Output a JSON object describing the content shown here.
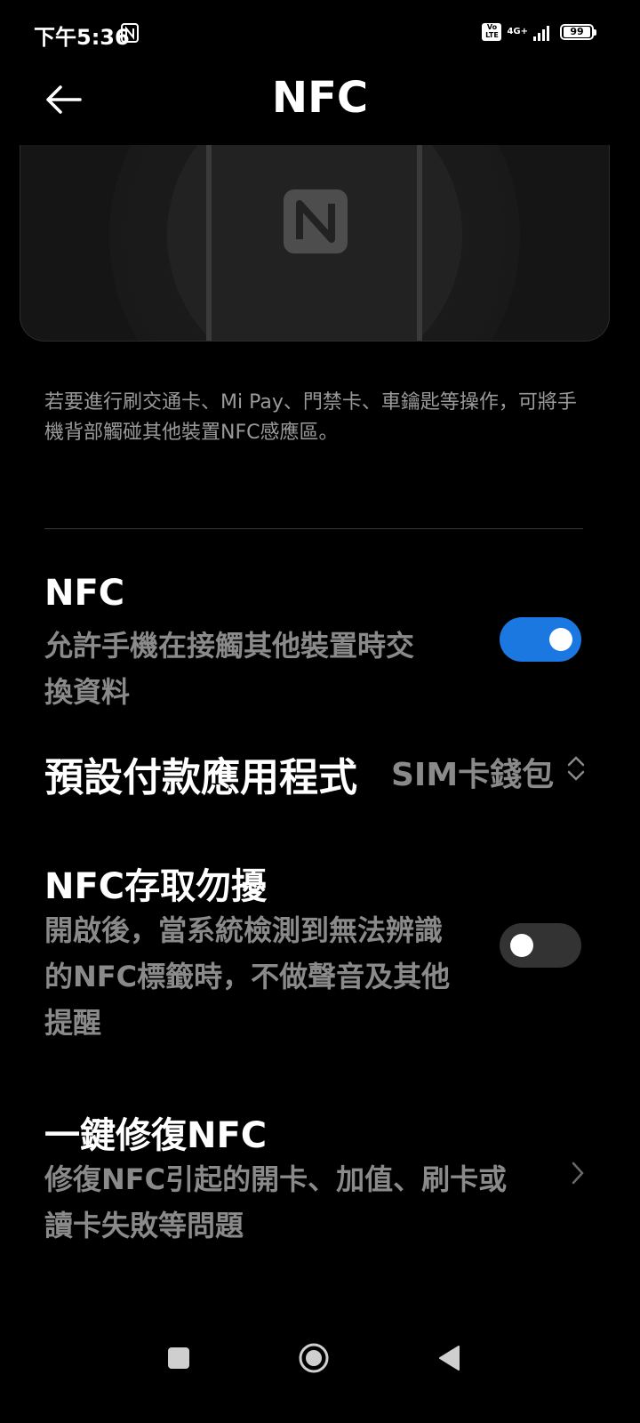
{
  "status_bar": {
    "time": "下午5:36",
    "volte": "Vo LTE",
    "network": "4G+",
    "battery": "99"
  },
  "header": {
    "title": "NFC"
  },
  "description": "若要進行刷交通卡、Mi Pay、門禁卡、車鑰匙等操作，可將手機背部觸碰其他裝置NFC感應區。",
  "settings": {
    "nfc": {
      "title": "NFC",
      "subtitle_line1": "允許手機在接觸其他裝置時交",
      "subtitle_line2": "換資料",
      "enabled": true
    },
    "default_payment": {
      "title": "預設付款應用程式",
      "value": "SIM卡錢包"
    },
    "do_not_disturb": {
      "title": "NFC存取勿擾",
      "subtitle_line1": "開啟後，當系統檢測到無法辨識",
      "subtitle_line2": "的NFC標籤時，不做聲音及其他",
      "subtitle_line3": "提醒",
      "enabled": false
    },
    "repair": {
      "title": "一鍵修復NFC",
      "subtitle_line1": "修復NFC引起的開卡、加值、刷卡或",
      "subtitle_line2": "讀卡失敗等問題"
    }
  },
  "colors": {
    "background": "#000000",
    "accent": "#1a78e0",
    "secondary_text": "#8a8a8a"
  }
}
